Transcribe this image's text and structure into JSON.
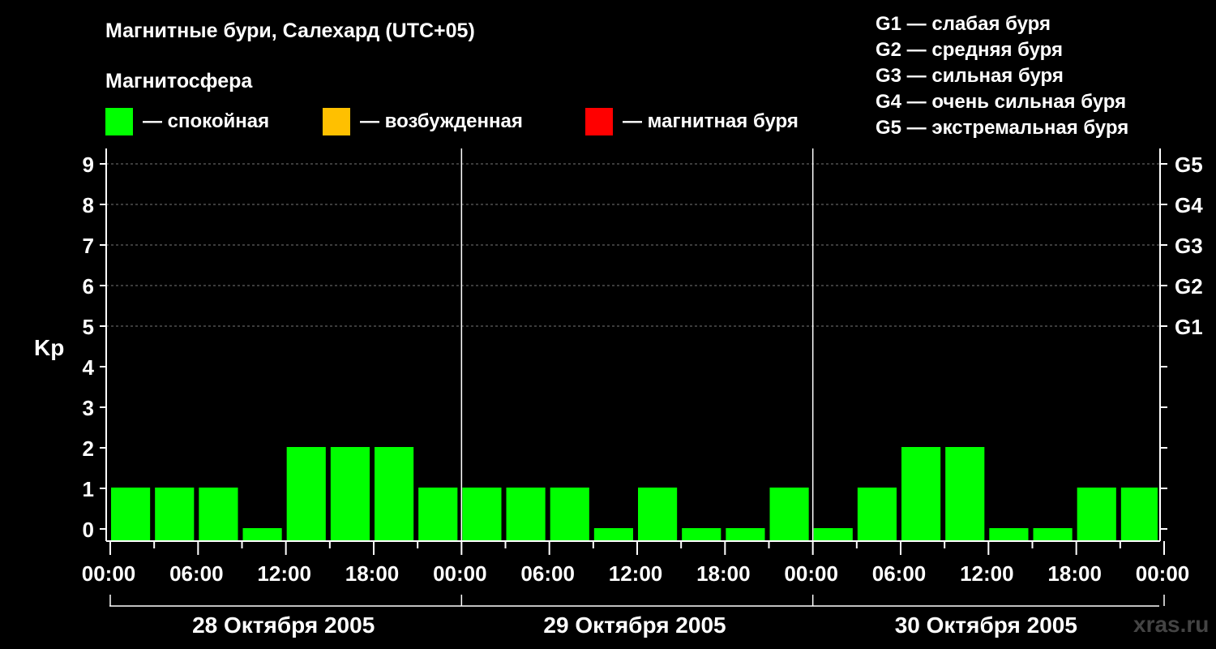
{
  "title": "Магнитные бури, Салехард (UTC+05)",
  "subtitle": "Магнитосфера",
  "legend": [
    {
      "label": "— спокойная",
      "color": "#00ff00"
    },
    {
      "label": "— возбужденная",
      "color": "#ffc000"
    },
    {
      "label": "— магнитная буря",
      "color": "#ff0000"
    }
  ],
  "storm_levels": [
    "G1 — слабая буря",
    "G2 — средняя буря",
    "G3 — сильная буря",
    "G4 — очень сильная буря",
    "G5 — экстремальная буря"
  ],
  "watermark": "xras.ru",
  "chart_data": {
    "type": "bar",
    "ylabel": "Kp",
    "ylim": [
      0,
      9
    ],
    "yticks": [
      "0",
      "1",
      "2",
      "3",
      "4",
      "5",
      "6",
      "7",
      "8",
      "9"
    ],
    "right_ticks": [
      {
        "value": 5,
        "label": "G1"
      },
      {
        "value": 6,
        "label": "G2"
      },
      {
        "value": 7,
        "label": "G3"
      },
      {
        "value": 8,
        "label": "G4"
      },
      {
        "value": 9,
        "label": "G5"
      }
    ],
    "xtick_labels": [
      "00:00",
      "06:00",
      "12:00",
      "18:00",
      "00:00",
      "06:00",
      "12:00",
      "18:00",
      "00:00",
      "06:00",
      "12:00",
      "18:00",
      "00:00"
    ],
    "days": [
      "28 Октября 2005",
      "29 Октября 2005",
      "30 Октября 2005"
    ],
    "interval_hours": 3,
    "values": [
      1,
      1,
      1,
      0,
      2,
      2,
      2,
      1,
      1,
      1,
      1,
      0,
      1,
      0,
      0,
      1,
      0,
      1,
      2,
      2,
      0,
      0,
      1,
      1
    ],
    "colors": {
      "quiet": "#00ff00",
      "active": "#ffc000",
      "storm": "#ff0000"
    },
    "grid_dashed_levels": [
      5,
      6,
      7,
      8,
      9
    ]
  }
}
